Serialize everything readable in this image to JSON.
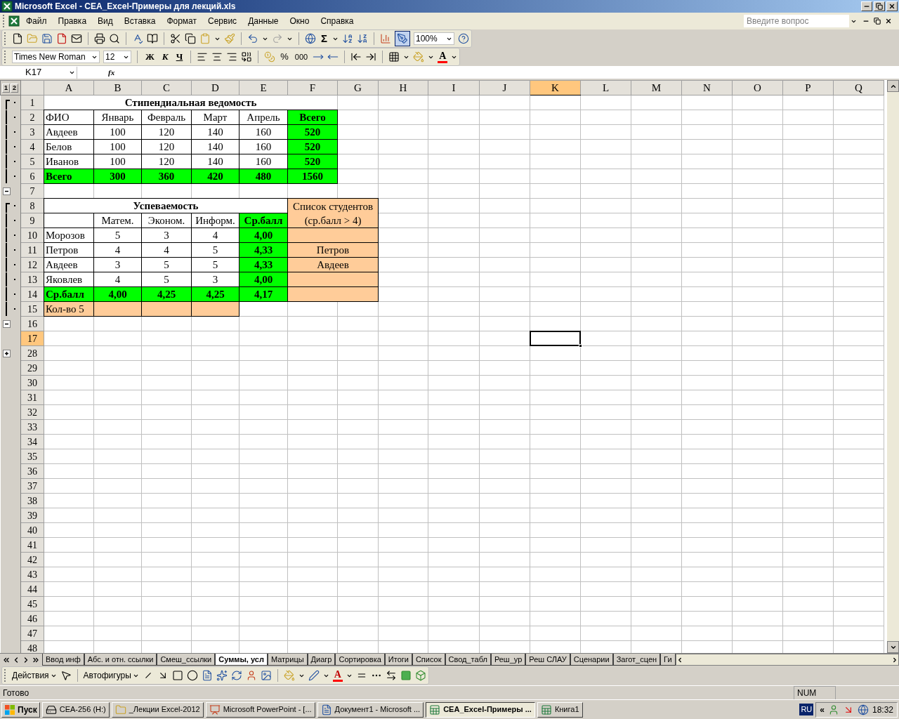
{
  "window": {
    "title": "Microsoft Excel - CEA_Excel-Примеры для лекций.xls"
  },
  "menu": [
    "Файл",
    "Правка",
    "Вид",
    "Вставка",
    "Формат",
    "Сервис",
    "Данные",
    "Окно",
    "Справка"
  ],
  "help_search": {
    "placeholder": "Введите вопрос"
  },
  "standard_toolbar": {
    "sum": "Σ",
    "zoom": "100%"
  },
  "format_toolbar": {
    "font": "Times New Roman",
    "size": "12",
    "bold": "Ж",
    "italic": "К",
    "underline": "Ч",
    "percent": "%",
    "thousands": "000",
    "font_color": "A"
  },
  "formula_bar": {
    "name_box": "K17",
    "fx": "fx"
  },
  "outline_levels": [
    "1",
    "2"
  ],
  "columns": [
    {
      "label": "A",
      "selected": false
    },
    {
      "label": "B",
      "selected": false
    },
    {
      "label": "C",
      "selected": false
    },
    {
      "label": "D",
      "selected": false
    },
    {
      "label": "E",
      "selected": false
    },
    {
      "label": "F",
      "selected": false
    },
    {
      "label": "G",
      "selected": false
    },
    {
      "label": "H",
      "selected": false
    },
    {
      "label": "I",
      "selected": false
    },
    {
      "label": "J",
      "selected": false
    },
    {
      "label": "K",
      "selected": true
    },
    {
      "label": "L",
      "selected": false
    },
    {
      "label": "M",
      "selected": false
    },
    {
      "label": "N",
      "selected": false
    },
    {
      "label": "O",
      "selected": false
    },
    {
      "label": "P",
      "selected": false
    },
    {
      "label": "Q",
      "selected": false
    }
  ],
  "rows": [
    {
      "number": "1",
      "selected": false,
      "kind": "group-start",
      "cells": [
        {
          "text": "Стипендиальная ведомость",
          "bold": true
        }
      ]
    },
    {
      "number": "2",
      "selected": false,
      "kind": "group-member",
      "cells": [
        {
          "text": "ФИО",
          "bold": false
        },
        {
          "text": "Январь",
          "bold": false
        },
        {
          "text": "Февраль",
          "bold": false
        },
        {
          "text": "Март",
          "bold": false
        },
        {
          "text": "Апрель",
          "bold": false
        },
        {
          "text": "Всего",
          "bold": true,
          "color": "#00ff00"
        }
      ]
    },
    {
      "number": "3",
      "selected": false,
      "kind": "group-member",
      "cells": [
        {
          "text": "Авдеев",
          "bold": false
        },
        {
          "text": "100",
          "bold": false
        },
        {
          "text": "120",
          "bold": false
        },
        {
          "text": "140",
          "bold": false
        },
        {
          "text": "160",
          "bold": false
        },
        {
          "text": "520",
          "bold": true,
          "color": "#00ff00"
        }
      ]
    },
    {
      "number": "4",
      "selected": false,
      "kind": "group-member",
      "cells": [
        {
          "text": "Белов",
          "bold": false
        },
        {
          "text": "100",
          "bold": false
        },
        {
          "text": "120",
          "bold": false
        },
        {
          "text": "140",
          "bold": false
        },
        {
          "text": "160",
          "bold": false
        },
        {
          "text": "520",
          "bold": true,
          "color": "#00ff00"
        }
      ]
    },
    {
      "number": "5",
      "selected": false,
      "kind": "group-member",
      "cells": [
        {
          "text": "Иванов",
          "bold": false
        },
        {
          "text": "100",
          "bold": false
        },
        {
          "text": "120",
          "bold": false
        },
        {
          "text": "140",
          "bold": false
        },
        {
          "text": "160",
          "bold": false
        },
        {
          "text": "520",
          "bold": true,
          "color": "#00ff00"
        }
      ]
    },
    {
      "number": "6",
      "selected": false,
      "kind": "group-member",
      "cells": [
        {
          "text": "Всего",
          "bold": true,
          "color": "#00ff00"
        },
        {
          "text": "300",
          "bold": true,
          "color": "#00ff00"
        },
        {
          "text": "360",
          "bold": true,
          "color": "#00ff00"
        },
        {
          "text": "420",
          "bold": true,
          "color": "#00ff00"
        },
        {
          "text": "480",
          "bold": true,
          "color": "#00ff00"
        },
        {
          "text": "1560",
          "bold": true,
          "color": "#00ff00"
        }
      ]
    },
    {
      "number": "7",
      "selected": false,
      "kind": "collapse"
    },
    {
      "number": "8",
      "selected": false,
      "kind": "group-start",
      "cells": [
        {
          "text": "Успеваемость",
          "bold": true
        },
        {
          "text": "Список студентов\n(ср.балл  > 4)",
          "bold": false,
          "color": "#ffcc99"
        }
      ]
    },
    {
      "number": "9",
      "selected": false,
      "kind": "group-member",
      "cells": [
        {},
        {
          "text": "Матем.",
          "bold": false
        },
        {
          "text": "Эконом.",
          "bold": false
        },
        {
          "text": "Информ.",
          "bold": false
        },
        {
          "text": "Ср.балл",
          "bold": true,
          "color": "#00ff00"
        }
      ]
    },
    {
      "number": "10",
      "selected": false,
      "kind": "group-member",
      "cells": [
        {
          "text": "Морозов",
          "bold": false
        },
        {
          "text": "5",
          "bold": false
        },
        {
          "text": "3",
          "bold": false
        },
        {
          "text": "4",
          "bold": false
        },
        {
          "text": "4,00",
          "bold": true,
          "color": "#00ff00"
        },
        {
          "color": "#ffcc99"
        }
      ]
    },
    {
      "number": "11",
      "selected": false,
      "kind": "group-member",
      "cells": [
        {
          "text": "Петров",
          "bold": false
        },
        {
          "text": "4",
          "bold": false
        },
        {
          "text": "4",
          "bold": false
        },
        {
          "text": "5",
          "bold": false
        },
        {
          "text": "4,33",
          "bold": true,
          "color": "#00ff00"
        },
        {
          "text": "Петров",
          "bold": false,
          "color": "#ffcc99"
        }
      ]
    },
    {
      "number": "12",
      "selected": false,
      "kind": "group-member",
      "cells": [
        {
          "text": "Авдеев",
          "bold": false
        },
        {
          "text": "3",
          "bold": false
        },
        {
          "text": "5",
          "bold": false
        },
        {
          "text": "5",
          "bold": false
        },
        {
          "text": "4,33",
          "bold": true,
          "color": "#00ff00"
        },
        {
          "text": "Авдеев",
          "bold": false,
          "color": "#ffcc99"
        }
      ]
    },
    {
      "number": "13",
      "selected": false,
      "kind": "group-member",
      "cells": [
        {
          "text": "Яковлев",
          "bold": false
        },
        {
          "text": "4",
          "bold": false
        },
        {
          "text": "5",
          "bold": false
        },
        {
          "text": "3",
          "bold": false
        },
        {
          "text": "4,00",
          "bold": true,
          "color": "#00ff00"
        },
        {
          "color": "#ffcc99"
        }
      ]
    },
    {
      "number": "14",
      "selected": false,
      "kind": "group-member",
      "cells": [
        {
          "text": "Ср.балл",
          "bold": true,
          "color": "#00ff00"
        },
        {
          "text": "4,00",
          "bold": true,
          "color": "#00ff00"
        },
        {
          "text": "4,25",
          "bold": true,
          "color": "#00ff00"
        },
        {
          "text": "4,25",
          "bold": true,
          "color": "#00ff00"
        },
        {
          "text": "4,17",
          "bold": true,
          "color": "#00ff00"
        },
        {
          "color": "#ffcc99"
        }
      ]
    },
    {
      "number": "15",
      "selected": false,
      "kind": "group-member",
      "cells": [
        {
          "text": "Кол-во 5",
          "bold": false,
          "color": "#ffcc99"
        },
        {
          "color": "#ffcc99"
        },
        {
          "color": "#ffcc99"
        },
        {
          "color": "#ffcc99"
        }
      ]
    },
    {
      "number": "16",
      "selected": false,
      "kind": "collapse"
    },
    {
      "number": "17",
      "selected": true
    },
    {
      "number": "28",
      "selected": false,
      "kind": "expand"
    },
    {
      "number": "29",
      "selected": false
    },
    {
      "number": "30",
      "selected": false
    },
    {
      "number": "31",
      "selected": false
    },
    {
      "number": "32",
      "selected": false
    },
    {
      "number": "33",
      "selected": false
    },
    {
      "number": "34",
      "selected": false
    },
    {
      "number": "35",
      "selected": false
    },
    {
      "number": "36",
      "selected": false
    },
    {
      "number": "37",
      "selected": false
    },
    {
      "number": "38",
      "selected": false
    },
    {
      "number": "39",
      "selected": false
    },
    {
      "number": "40",
      "selected": false
    },
    {
      "number": "41",
      "selected": false
    },
    {
      "number": "42",
      "selected": false
    },
    {
      "number": "43",
      "selected": false
    },
    {
      "number": "44",
      "selected": false
    },
    {
      "number": "45",
      "selected": false
    },
    {
      "number": "46",
      "selected": false
    },
    {
      "number": "47",
      "selected": false
    },
    {
      "number": "48",
      "selected": false
    }
  ],
  "sheet_tabs": [
    {
      "label": "Ввод инф",
      "selected": false
    },
    {
      "label": "Абс. и отн. ссылки",
      "selected": false
    },
    {
      "label": "Смеш_ссылки",
      "selected": false
    },
    {
      "label": "Суммы, усл",
      "selected": true
    },
    {
      "label": "Матрицы",
      "selected": false
    },
    {
      "label": "Диагр",
      "selected": false
    },
    {
      "label": "Сортировка",
      "selected": false
    },
    {
      "label": "Итоги",
      "selected": false
    },
    {
      "label": "Список",
      "selected": false
    },
    {
      "label": "Свод_табл",
      "selected": false
    },
    {
      "label": "Реш_ур",
      "selected": false
    },
    {
      "label": "Реш СЛАУ",
      "selected": false
    },
    {
      "label": "Сценарии",
      "selected": false
    },
    {
      "label": "Загот_сцен",
      "selected": false
    },
    {
      "label": "Ги",
      "selected": false
    }
  ],
  "drawing_toolbar": {
    "actions": "Действия",
    "autoshapes": "Автофигуры",
    "font_color": "A"
  },
  "status_bar": {
    "message": "Готово",
    "num": "NUM"
  },
  "taskbar": {
    "start": "Пуск",
    "items": [
      {
        "kind": "drive",
        "label": "CEA-256 (H:)",
        "selected": false
      },
      {
        "kind": "folder",
        "label": "_Лекции Excel-2012",
        "selected": false
      },
      {
        "kind": "powerpoint",
        "label": "Microsoft PowerPoint - [...",
        "selected": false
      },
      {
        "kind": "word",
        "label": "Документ1 - Microsoft ...",
        "selected": false
      },
      {
        "kind": "excel",
        "label": "CEA_Excel-Примеры ...",
        "selected": true
      },
      {
        "kind": "excel",
        "label": "Книга1",
        "selected": false
      }
    ],
    "language": "RU",
    "tray_expand": "«",
    "clock": "18:32"
  }
}
